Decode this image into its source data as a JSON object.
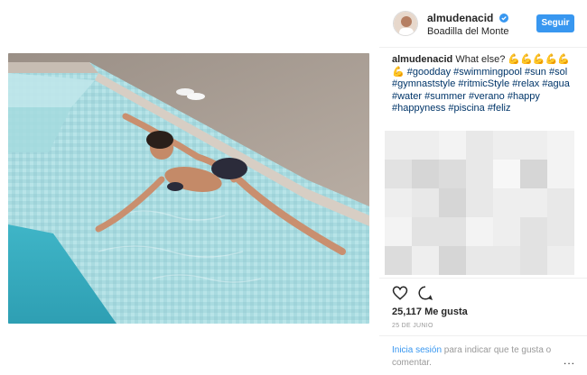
{
  "post": {
    "username": "almudenacid",
    "location": "Boadilla del Monte",
    "follow_label": "Seguir",
    "caption_user": "almudenacid",
    "caption_text": "What else? 💪💪💪💪💪💪",
    "hashtags": [
      "#goodday",
      "#swimmingpool",
      "#sun",
      "#sol",
      "#gymnaststyle",
      "#ritmicStyle",
      "#relax",
      "#agua",
      "#water",
      "#summer",
      "#verano",
      "#happy",
      "#happyness",
      "#piscina",
      "#feliz"
    ],
    "likes": "25,117 Me gusta",
    "date": "25 DE JUNIO",
    "login_link": "Inicia sesión",
    "login_text": " para indicar que te gusta o comentar.",
    "more_label": "..."
  },
  "colors": {
    "accent": "#3897f0",
    "hashtag": "#003569",
    "muted": "#999999",
    "verified": "#3897f0"
  },
  "icons": {
    "like": "heart-icon",
    "comment": "comment-icon",
    "verified": "verified-badge-icon"
  }
}
